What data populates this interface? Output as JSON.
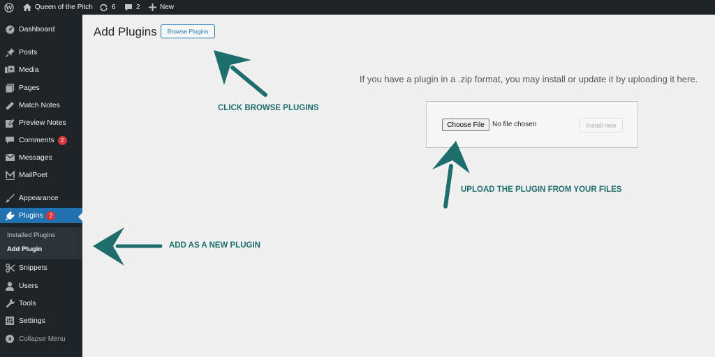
{
  "admin_bar": {
    "site_name": "Queen of the Pitch",
    "updates_count": "6",
    "comments_count": "2",
    "new_label": "New"
  },
  "sidebar": {
    "items": [
      {
        "label": "Dashboard",
        "icon": "dashboard-icon"
      },
      {
        "label": "Posts",
        "icon": "pin-icon"
      },
      {
        "label": "Media",
        "icon": "media-icon"
      },
      {
        "label": "Pages",
        "icon": "pages-icon"
      },
      {
        "label": "Match Notes",
        "icon": "pencil-icon"
      },
      {
        "label": "Preview Notes",
        "icon": "edit-icon"
      },
      {
        "label": "Comments",
        "icon": "comment-icon",
        "badge": "2"
      },
      {
        "label": "Messages",
        "icon": "mail-icon"
      },
      {
        "label": "MailPoet",
        "icon": "mailpoet-icon"
      },
      {
        "label": "Appearance",
        "icon": "brush-icon"
      },
      {
        "label": "Plugins",
        "icon": "plugin-icon",
        "badge": "2"
      },
      {
        "label": "Snippets",
        "icon": "scissors-icon"
      },
      {
        "label": "Users",
        "icon": "user-icon"
      },
      {
        "label": "Tools",
        "icon": "wrench-icon"
      },
      {
        "label": "Settings",
        "icon": "settings-icon"
      }
    ],
    "submenu": [
      {
        "label": "Installed Plugins"
      },
      {
        "label": "Add Plugin"
      }
    ],
    "collapse_label": "Collapse Menu"
  },
  "main": {
    "page_title": "Add Plugins",
    "browse_button": "Browse Plugins",
    "help_text": "If you have a plugin in a .zip format, you may install or update it by uploading it here.",
    "choose_file": "Choose File",
    "no_file": "No file chosen",
    "install_now": "Install now"
  },
  "annotations": {
    "browse": "CLICK BROWSE PLUGINS",
    "upload": "UPLOAD THE PLUGIN FROM YOUR FILES",
    "add": "ADD AS A NEW PLUGIN"
  },
  "colors": {
    "admin_dark": "#1d2327",
    "accent_blue": "#2271b1",
    "badge_red": "#d63638",
    "annotation_teal": "#1e6e6e"
  }
}
